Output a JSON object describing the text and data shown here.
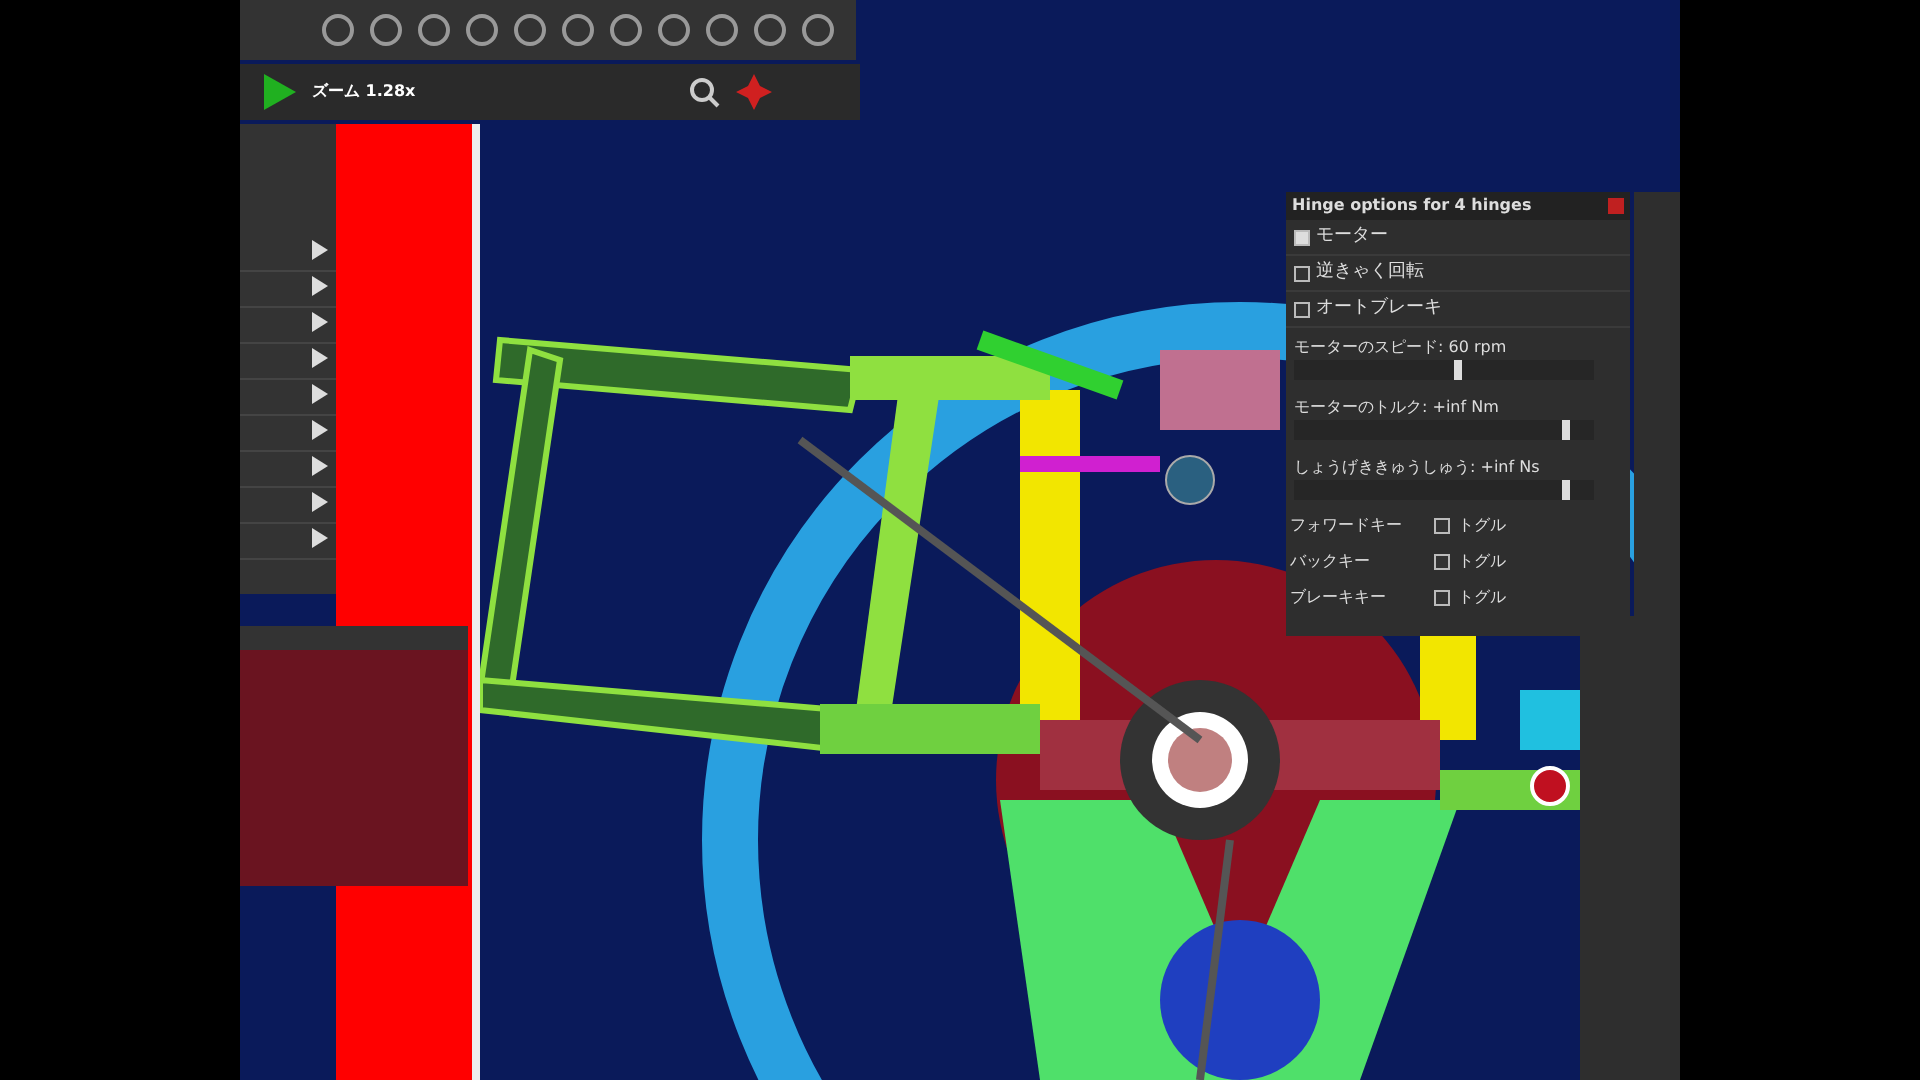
{
  "toolbar": {
    "zoom_label": "ズーム 1.28x"
  },
  "hinge_panel": {
    "title": "Hinge options for 4 hinges",
    "options": [
      {
        "label": "モーター",
        "checked": true
      },
      {
        "label": "逆きゃく回転",
        "checked": false
      },
      {
        "label": "オートブレーキ",
        "checked": false
      }
    ],
    "sliders": [
      {
        "label": "モーターのスピード: 60 rpm",
        "level": 0.55
      },
      {
        "label": "モーターのトルク: +inf Nm",
        "level": 0.92
      },
      {
        "label": "しょうげききゅうしゅう: +inf Ns",
        "level": 0.92
      }
    ],
    "keys": [
      {
        "label": "フォワードキー",
        "toggle": "トグル",
        "checked": false
      },
      {
        "label": "バックキー",
        "toggle": "トグル",
        "checked": false
      },
      {
        "label": "ブレーキキー",
        "toggle": "トグル",
        "checked": false
      }
    ]
  }
}
